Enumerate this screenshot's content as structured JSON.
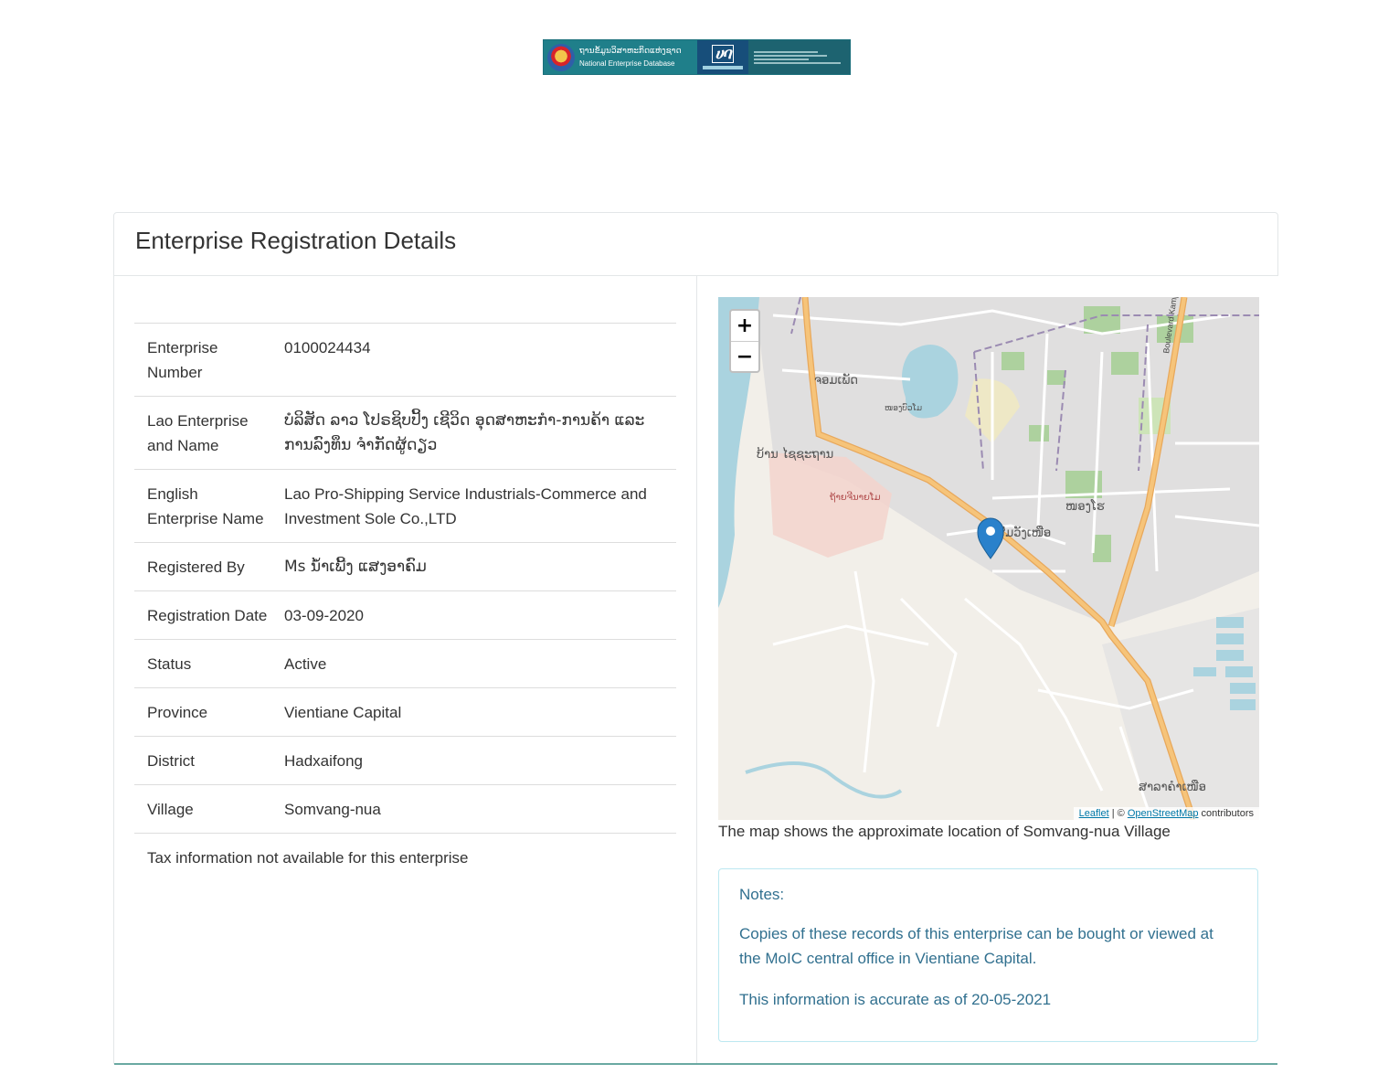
{
  "banner": {
    "lao_text": "ຖານຂໍ້ມູນວິສາຫະກິດແຫ່ງຊາດ",
    "english_text": "National Enterprise Database"
  },
  "panel": {
    "title": "Enterprise Registration Details"
  },
  "details": {
    "rows": [
      {
        "label": "Enterprise Number",
        "value": "0100024434"
      },
      {
        "label": "Lao Enterprise and Name",
        "value": "ບໍລິສັດ ລາວ ໂປຣຊິບປິ້ງ ເຊີວິດ ອຸດສາຫະກຳ-ການຄ້າ ແລະ ການລົງທຶນ ຈຳກັດຜູ້ດຽວ"
      },
      {
        "label": "English Enterprise Name",
        "value": "Lao Pro-Shipping Service Industrials-Commerce and Investment Sole Co.,LTD"
      },
      {
        "label": "Registered By",
        "value": "Ms ນ້ຳເພີ້ງ ແສງອາຄົມ"
      },
      {
        "label": "Registration Date",
        "value": "03-09-2020"
      },
      {
        "label": "Status",
        "value": "Active"
      },
      {
        "label": "Province",
        "value": "Vientiane Capital"
      },
      {
        "label": "District",
        "value": "Hadxaifong"
      },
      {
        "label": "Village",
        "value": "Somvang-nua"
      }
    ],
    "tax_note": "Tax information not available for this enterprise"
  },
  "map": {
    "zoom_in": "+",
    "zoom_out": "−",
    "attribution_leaflet": "Leaflet",
    "attribution_sep": " | © ",
    "attribution_osm": "OpenStreetMap",
    "attribution_suffix": " contributors",
    "labels": {
      "l1": "ຈອມເພັດ",
      "l2": "ບ້ານ ໄຊຊະຖານ",
      "l3": "ຖ້າຍຈີນາຍໂມ",
      "l4": "ໜອງໂຮ",
      "l5": "ສົມວັງເໜືອ",
      "l6": "ສາລາຄຳເໜືອ",
      "l7": "Boulevard Kamphengmeuang",
      "l8": "ໜອງບົວໂມ"
    },
    "caption": "The map shows the approximate location of Somvang-nua Village"
  },
  "notes": {
    "title": "Notes:",
    "copies": "Copies of these records of this enterprise can be bought or viewed at the MoIC central office in Vientiane Capital.",
    "accuracy": "This information is accurate as of 20-05-2021"
  },
  "colors": {
    "accent": "#1f7f8a",
    "notes_text": "#31708f",
    "notes_border": "#bce8f1",
    "marker": "#2a81cb",
    "road_major": "#f6c47a",
    "river": "#aad3df"
  }
}
